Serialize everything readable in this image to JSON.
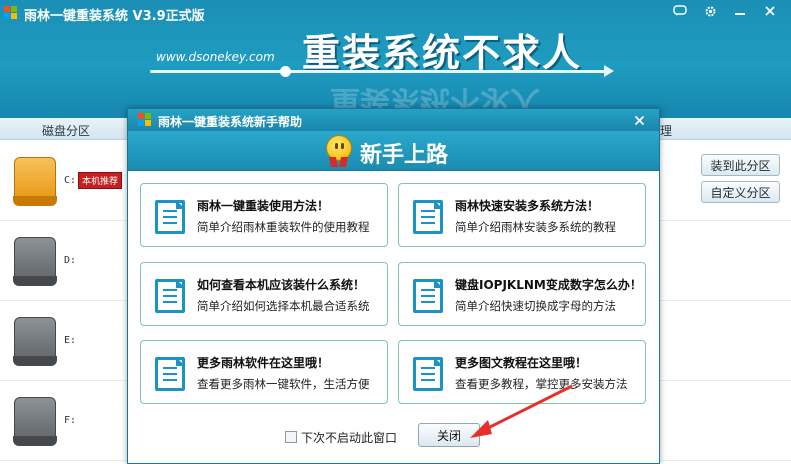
{
  "app": {
    "title": "雨林一键重装系统 V3.9正式版",
    "slogan": "重装系统不求人",
    "site_url": "www.dsonekey.com",
    "window_buttons": [
      "chat-icon",
      "gear-icon",
      "minimize-icon",
      "close-icon"
    ]
  },
  "partition": {
    "tab_label": "磁盘分区",
    "tab_label_right": "理",
    "disks": [
      {
        "letter": "C:",
        "badge": "本机推荐",
        "color": "orange"
      },
      {
        "letter": "D:",
        "badge": "",
        "color": "gray"
      },
      {
        "letter": "E:",
        "badge": "",
        "color": "gray"
      },
      {
        "letter": "F:",
        "badge": "",
        "color": "gray"
      }
    ],
    "install_button": "装到此分区",
    "custom_button": "自定义分区"
  },
  "dialog": {
    "title": "雨林一键重装系统新手帮助",
    "banner": "新手上路",
    "cards": [
      {
        "title": "雨林一键重装使用方法！",
        "desc": "简单介绍雨林重装软件的使用教程"
      },
      {
        "title": "雨林快速安装多系统方法！",
        "desc": "简单介绍雨林安装多系统的教程"
      },
      {
        "title": "如何查看本机应该装什么系统！",
        "desc": "简单介绍如何选择本机最合适系统"
      },
      {
        "title": "键盘IOPJKLNM变成数字怎么办！",
        "desc": "简单介绍快速切换成字母的方法"
      },
      {
        "title": "更多雨林软件在这里哦！",
        "desc": "查看更多雨林一键软件，生活方便"
      },
      {
        "title": "更多图文教程在这里哦！",
        "desc": "查看更多教程，掌控更多安装方法"
      }
    ],
    "checkbox_label": "下次不启动此窗口",
    "close_button": "关闭"
  },
  "colors": {
    "header_blue": "#1f9cc1",
    "card_border": "#7fc7a2",
    "icon_blue": "#1a93c6",
    "badge_red": "#c51f1f",
    "annotation_arrow": "#e8302b"
  }
}
